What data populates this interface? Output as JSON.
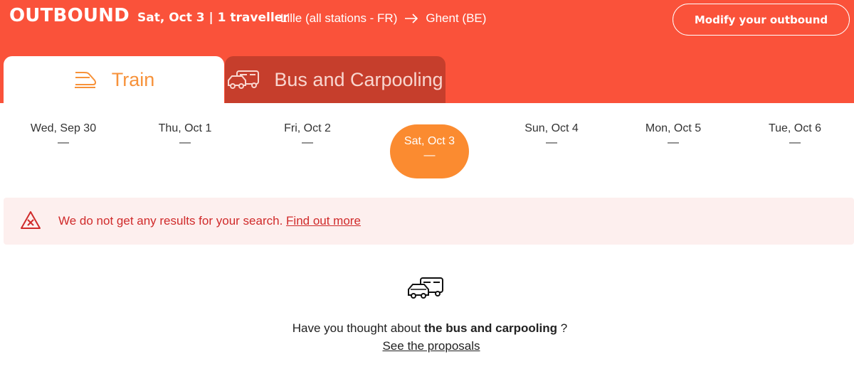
{
  "header": {
    "title": "OUTBOUND",
    "date_travellers": "Sat, Oct 3 | 1 traveller",
    "origin": "Lille (all stations - FR)",
    "destination": "Ghent (BE)",
    "modify_label": "Modify your outbound",
    "bg_color": "#fa523a"
  },
  "tabs": [
    {
      "label": "Train",
      "icon": "train-icon",
      "active": true
    },
    {
      "label": "Bus and Carpooling",
      "icon": "bus-car-icon",
      "active": false
    }
  ],
  "dates": [
    {
      "label": "Wed, Sep 30",
      "price": "—"
    },
    {
      "label": "Thu, Oct 1",
      "price": "—"
    },
    {
      "label": "Fri, Oct 2",
      "price": "—"
    },
    {
      "label": "Sat, Oct 3",
      "price": "—",
      "selected": true
    },
    {
      "label": "Sun, Oct 4",
      "price": "—"
    },
    {
      "label": "Mon, Oct 5",
      "price": "—"
    },
    {
      "label": "Tue, Oct 6",
      "price": "—"
    }
  ],
  "alert": {
    "icon": "error-triangle-icon",
    "message": "We do not get any results for your search.",
    "link_label": "Find out more",
    "text_color": "#d02a2a"
  },
  "promo": {
    "icon": "bus-car-icon",
    "text_before": "Have you thought about",
    "text_bold": "the bus and carpooling",
    "text_after": "?",
    "link_label": "See the proposals"
  },
  "colors": {
    "selected_date": "#fb8b30",
    "train_tab_text": "#f7923a",
    "bus_tab_bg": "#c63e2c"
  }
}
